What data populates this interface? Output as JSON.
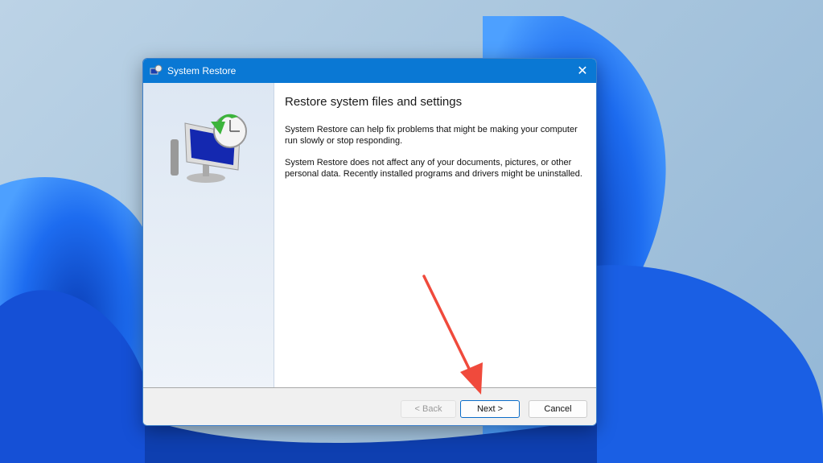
{
  "window": {
    "title": "System Restore",
    "close_icon": "close-icon"
  },
  "content": {
    "heading": "Restore system files and settings",
    "paragraph1": "System Restore can help fix problems that might be making your computer run slowly or stop responding.",
    "paragraph2": "System Restore does not affect any of your documents, pictures, or other personal data. Recently installed programs and drivers might be uninstalled."
  },
  "buttons": {
    "back": "< Back",
    "next": "Next >",
    "cancel": "Cancel"
  },
  "colors": {
    "titlebar": "#0a78d4",
    "annotation_arrow": "#f04a3c"
  }
}
